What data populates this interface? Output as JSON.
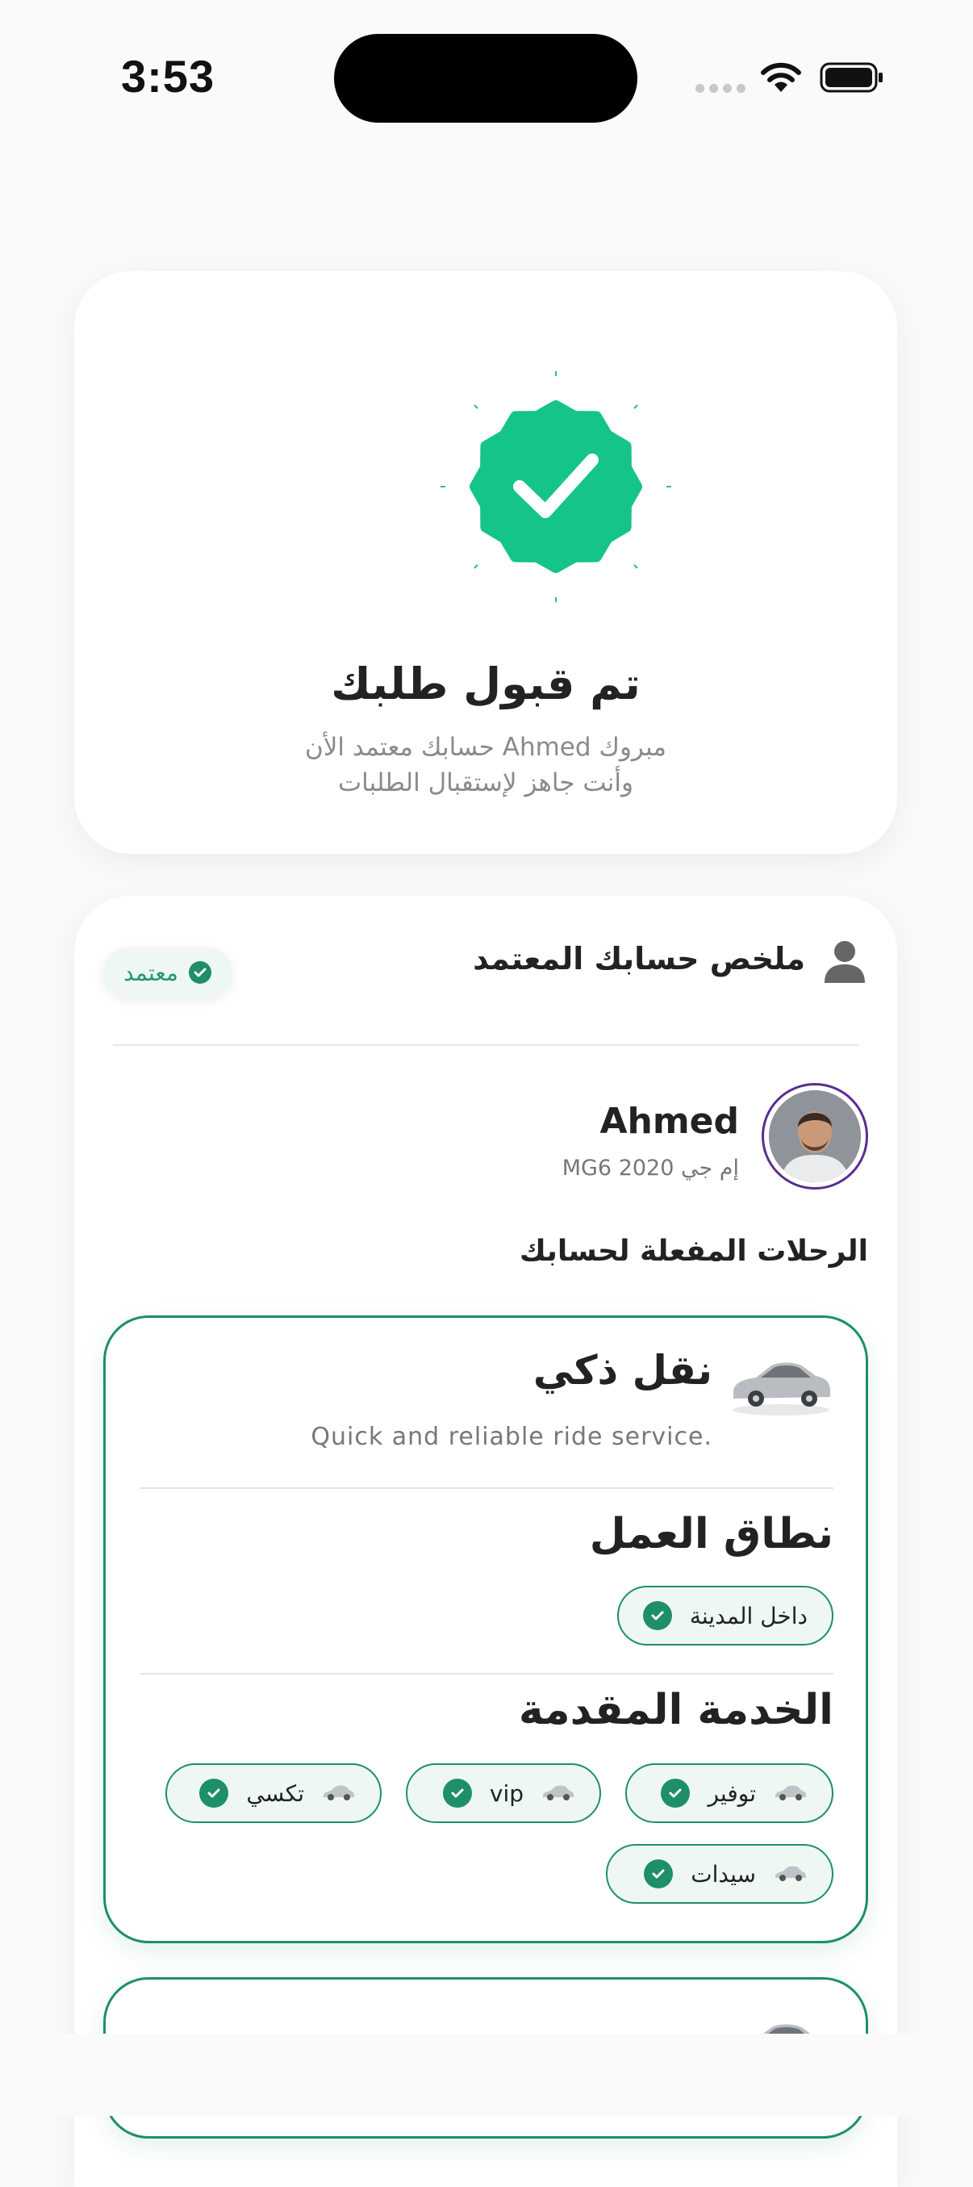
{
  "status_bar": {
    "time": "3:53"
  },
  "confirmation": {
    "title": "تم قبول طلبك",
    "line1": "مبروك Ahmed حسابك معتمد الأن",
    "line2": "وأنت جاهز لإستقبال الطلبات",
    "accent_color": "#15c488"
  },
  "summary": {
    "title": "ملخص حسابك المعتمد",
    "approved_label": "معتمد",
    "user_name": "Ahmed",
    "car_model": "إم جي MG6 2020",
    "trips_section_label": "الرحلات المفعلة لحسابك"
  },
  "services": [
    {
      "title": "نقل ذكي",
      "description": "Quick and reliable ride service.",
      "scope_heading": "نطاق العمل",
      "scope_items": [
        "داخل المدينة"
      ],
      "offered_heading": "الخدمة المقدمة",
      "offered_items": [
        "توفير",
        "vip",
        "تكسي",
        "سيدات"
      ]
    }
  ],
  "colors": {
    "primary": "#1e8f68",
    "chip_bg": "#eef7f2",
    "badge": "#15c488"
  }
}
